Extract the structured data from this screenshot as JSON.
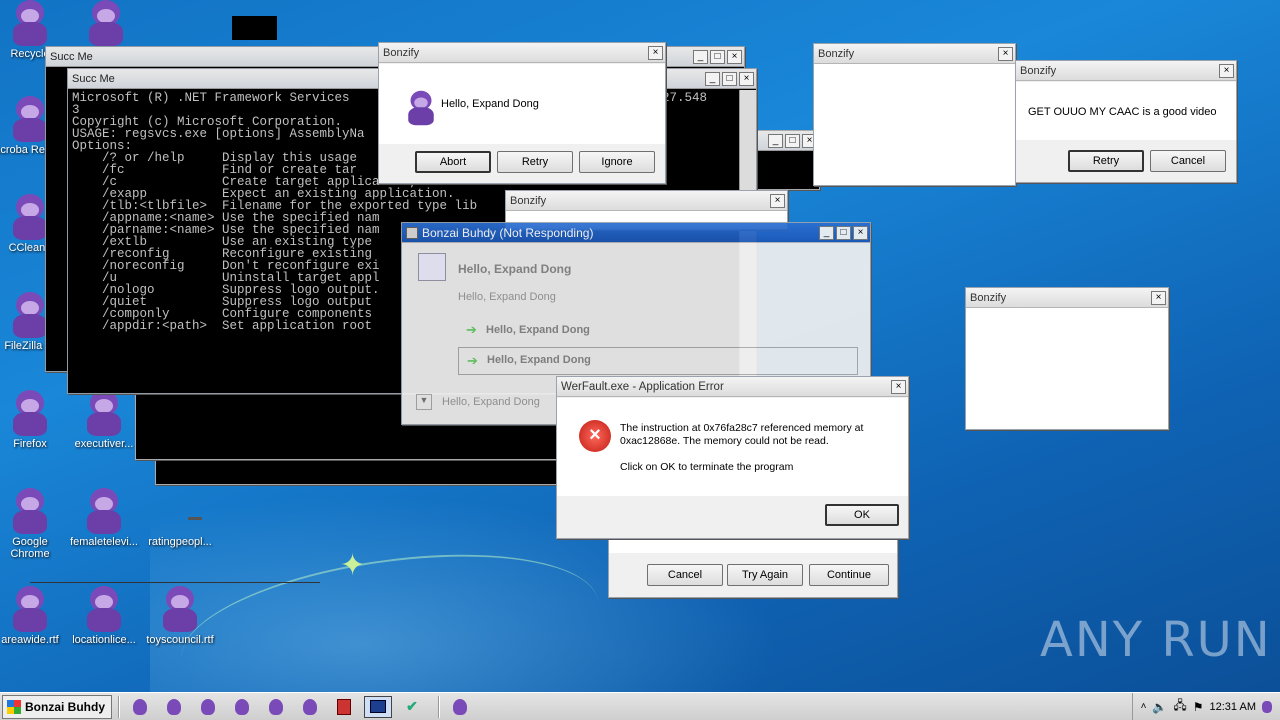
{
  "desktop": {
    "icons": [
      {
        "label": "Recycle"
      },
      {
        "label": "Acroba Reader"
      },
      {
        "label": "CCleane"
      },
      {
        "label": "FileZilla Cl"
      },
      {
        "label": "Firefox"
      },
      {
        "label": "executiver..."
      },
      {
        "label": "Google Chrome"
      },
      {
        "label": "femaletelevi..."
      },
      {
        "label": "ratingpeopl..."
      },
      {
        "label": "areawide.rtf"
      },
      {
        "label": "locationlice..."
      },
      {
        "label": "toyscouncil.rtf"
      }
    ],
    "watermark": "ANY RUN"
  },
  "console_back": {
    "title": "Succ Me"
  },
  "console_front": {
    "title": "Succ Me",
    "lines": [
      "Microsoft (R) .NET Framework Services",
      "3",
      "Copyright (c) Microsoft Corporation.",
      "",
      "USAGE: regsvcs.exe [options] AssemblyNa",
      "Options:",
      "    /? or /help     Display this usage",
      "    /fc             Find or create tar",
      "    /c              Create target application, error i",
      "    /exapp          Expect an existing application.",
      "    /tlb:<tlbfile>  Filename for the exported type lib",
      "    /appname:<name> Use the specified nam",
      "    /parname:<name> Use the specified nam",
      "    /extlb          Use an existing type",
      "    /reconfig       Reconfigure existing",
      "    /noreconfig     Don't reconfigure exi",
      "    /u              Uninstall target appl",
      "    /nologo         Suppress logo output.",
      "    /quiet          Suppress logo output",
      "    /componly       Configure components",
      "    /appdir:<path>  Set application root"
    ],
    "version_fragment": "27.548"
  },
  "bonzify_1": {
    "title": "Bonzify",
    "message": "Hello, Expand Dong",
    "buttons": [
      "Abort",
      "Retry",
      "Ignore"
    ]
  },
  "bonzify_2": {
    "title": "Bonzify"
  },
  "bonzify_3": {
    "title": "Bonzify",
    "message": "GET OUUO MY CAAC is a good video",
    "buttons": [
      "Retry",
      "Cancel"
    ]
  },
  "bonzify_4": {
    "title": "Bonzify"
  },
  "bonzify_5": {
    "title": "Bonzify"
  },
  "not_responding": {
    "title": "Bonzai Buhdy (Not Responding)",
    "heading": "Hello, Expand Dong",
    "subtext": "Hello, Expand Dong",
    "option1": "Hello, Expand Dong",
    "option2": "Hello, Expand Dong",
    "details": "Hello, Expand Dong"
  },
  "hidden_dialog": {
    "buttons": [
      "Cancel",
      "Try Again",
      "Continue"
    ]
  },
  "werfault": {
    "title": "WerFault.exe - Application Error",
    "message": "The instruction at 0x76fa28c7 referenced memory at 0xac12868e. The memory could not be read.",
    "message2": "Click on OK to terminate the program",
    "ok": "OK"
  },
  "taskbar": {
    "start_label": "Bonzai Buhdy",
    "clock": "12:31 AM"
  }
}
